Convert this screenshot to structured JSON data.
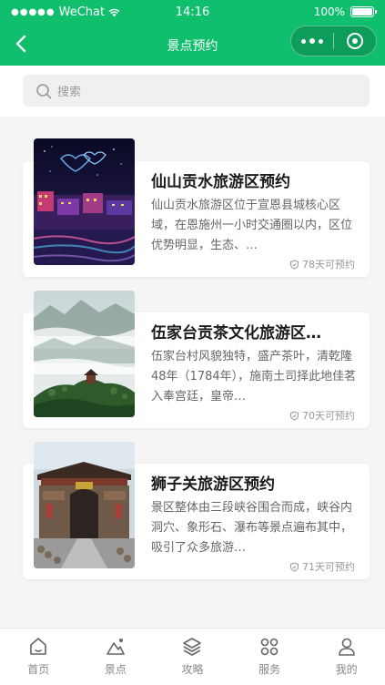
{
  "status_bar": {
    "carrier": "WeChat",
    "time": "14:16",
    "battery": "100%"
  },
  "nav": {
    "title": "景点预约"
  },
  "search": {
    "placeholder": "搜索"
  },
  "cards": [
    {
      "title": "仙山贡水旅游区预约",
      "desc": "仙山贡水旅游区位于宣恩县城核心区域，在恩施州一小时交通圈以内，区位优势明显，生态、…",
      "badge": "78天可预约"
    },
    {
      "title": "伍家台贡茶文化旅游区…",
      "desc": "伍家台村风貌独特，盛产茶叶，清乾隆48年（1784年），施南土司择此地佳茗入奉宫廷，皇帝…",
      "badge": "70天可预约"
    },
    {
      "title": "狮子关旅游区预约",
      "desc": "景区整体由三段峡谷围合而成，峡谷内洞穴、象形石、瀑布等景点遍布其中，吸引了众多旅游…",
      "badge": "71天可预约"
    }
  ],
  "tabs": [
    {
      "label": "首页",
      "icon": "home-icon"
    },
    {
      "label": "景点",
      "icon": "mountain-icon"
    },
    {
      "label": "攻略",
      "icon": "layers-icon"
    },
    {
      "label": "服务",
      "icon": "grid-icon"
    },
    {
      "label": "我的",
      "icon": "user-icon"
    }
  ],
  "colors": {
    "brand": "#10bf6e"
  }
}
